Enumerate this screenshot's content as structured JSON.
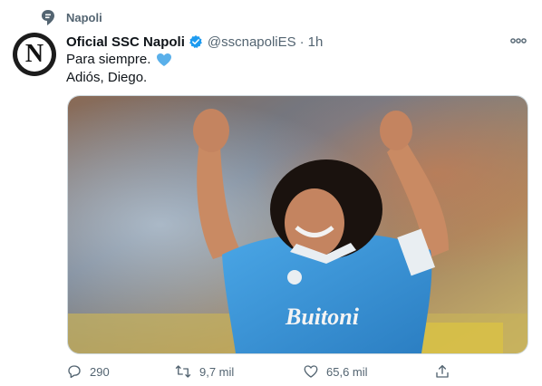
{
  "topic": {
    "label": "Napoli",
    "icon": "speech-bubble-pin-icon"
  },
  "author": {
    "name": "Oficial SSC Napoli",
    "handle": "@sscnapoliES",
    "separator": "·",
    "time": "1h",
    "verified_color": "#1d9bf0",
    "avatar_letter": "N"
  },
  "tweet": {
    "line1": "Para siempre.",
    "line2": "Adiós, Diego.",
    "emoji": "blue-heart",
    "emoji_color": "#5ab0ea"
  },
  "media": {
    "description_icon": "player-celebrating-photo",
    "jersey_text": "Buitoni"
  },
  "actions": {
    "reply_count": "290",
    "retweet_count": "9,7 mil",
    "like_count": "65,6 mil"
  },
  "colors": {
    "secondary_text": "#536471",
    "primary_text": "#0f1419",
    "border": "#cfd9de"
  }
}
